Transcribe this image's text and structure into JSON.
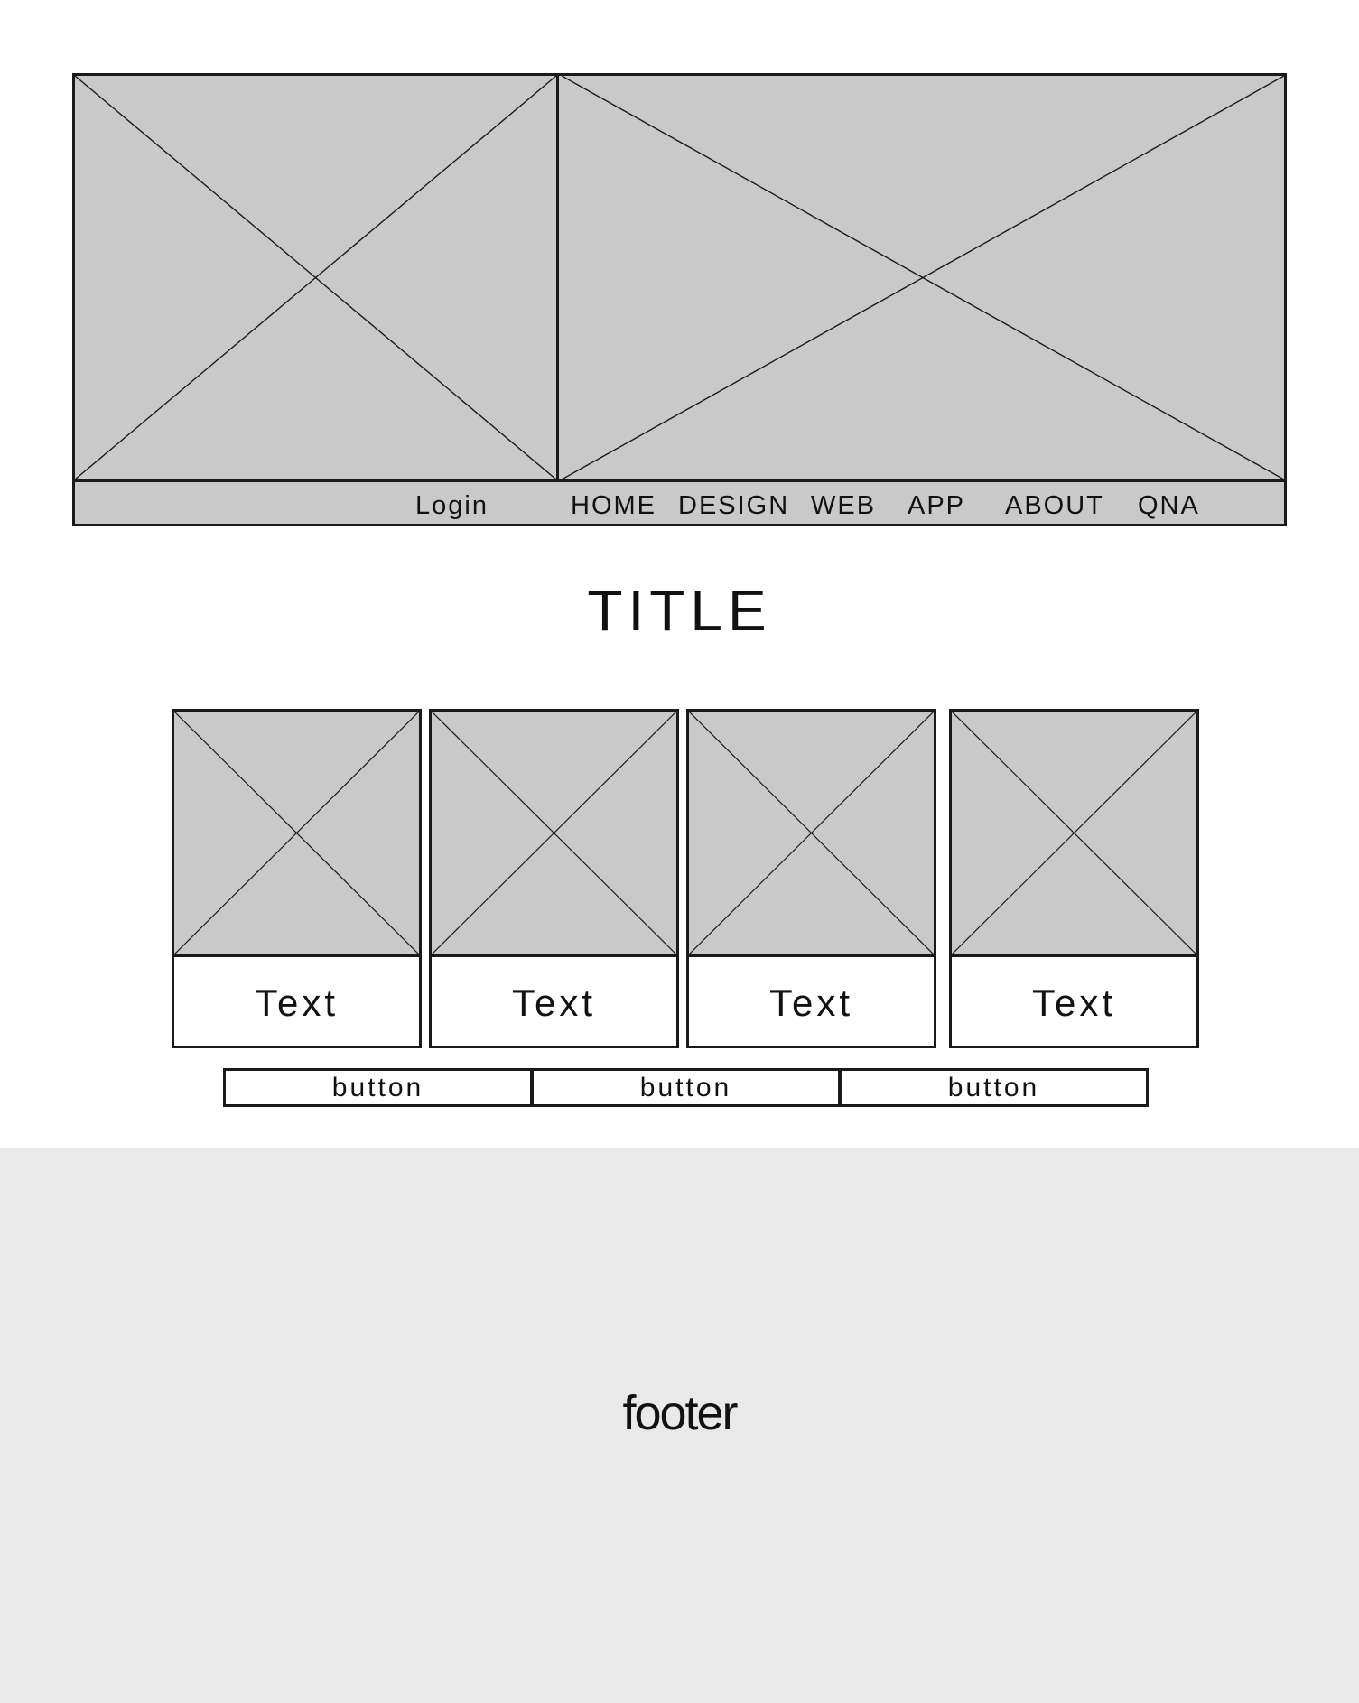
{
  "colors": {
    "placeholder_fill": "#c9c9c9",
    "stroke": "#1a1a1a",
    "footer_bg": "#e9e9e9",
    "page_bg": "#ffffff"
  },
  "header": {
    "logo_placeholder_icon": "image-placeholder-icon",
    "banner_placeholder_icon": "image-placeholder-icon",
    "nav": {
      "login": "Login",
      "items": [
        "HOME",
        "DESIGN",
        "WEB",
        "APP",
        "ABOUT",
        "QNA"
      ]
    }
  },
  "title": "TITLE",
  "cards": [
    {
      "image_icon": "image-placeholder-icon",
      "text": "Text"
    },
    {
      "image_icon": "image-placeholder-icon",
      "text": "Text"
    },
    {
      "image_icon": "image-placeholder-icon",
      "text": "Text"
    },
    {
      "image_icon": "image-placeholder-icon",
      "text": "Text"
    }
  ],
  "buttons": [
    "button",
    "button",
    "button"
  ],
  "footer": {
    "label": "footer"
  }
}
